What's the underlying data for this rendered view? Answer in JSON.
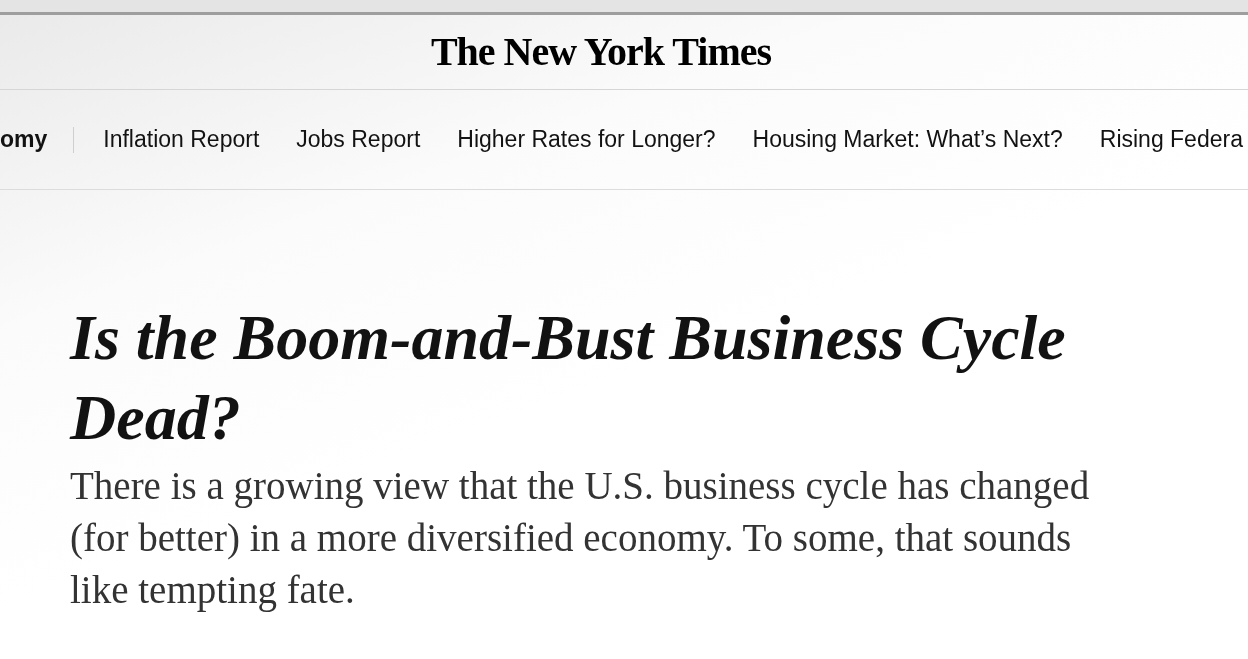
{
  "masthead": {
    "logo": "The New York Times"
  },
  "nav": {
    "section_label": "omy",
    "items": [
      "Inflation Report",
      "Jobs Report",
      "Higher Rates for Longer?",
      "Housing Market: What’s Next?",
      "Rising Federa"
    ]
  },
  "article": {
    "headline": "Is the Boom-and-Bust Business Cycle Dead?",
    "summary": "There is a growing view that the U.S. business cycle has changed (for better) in a more diversified economy. To some, that sounds like tempting fate."
  }
}
